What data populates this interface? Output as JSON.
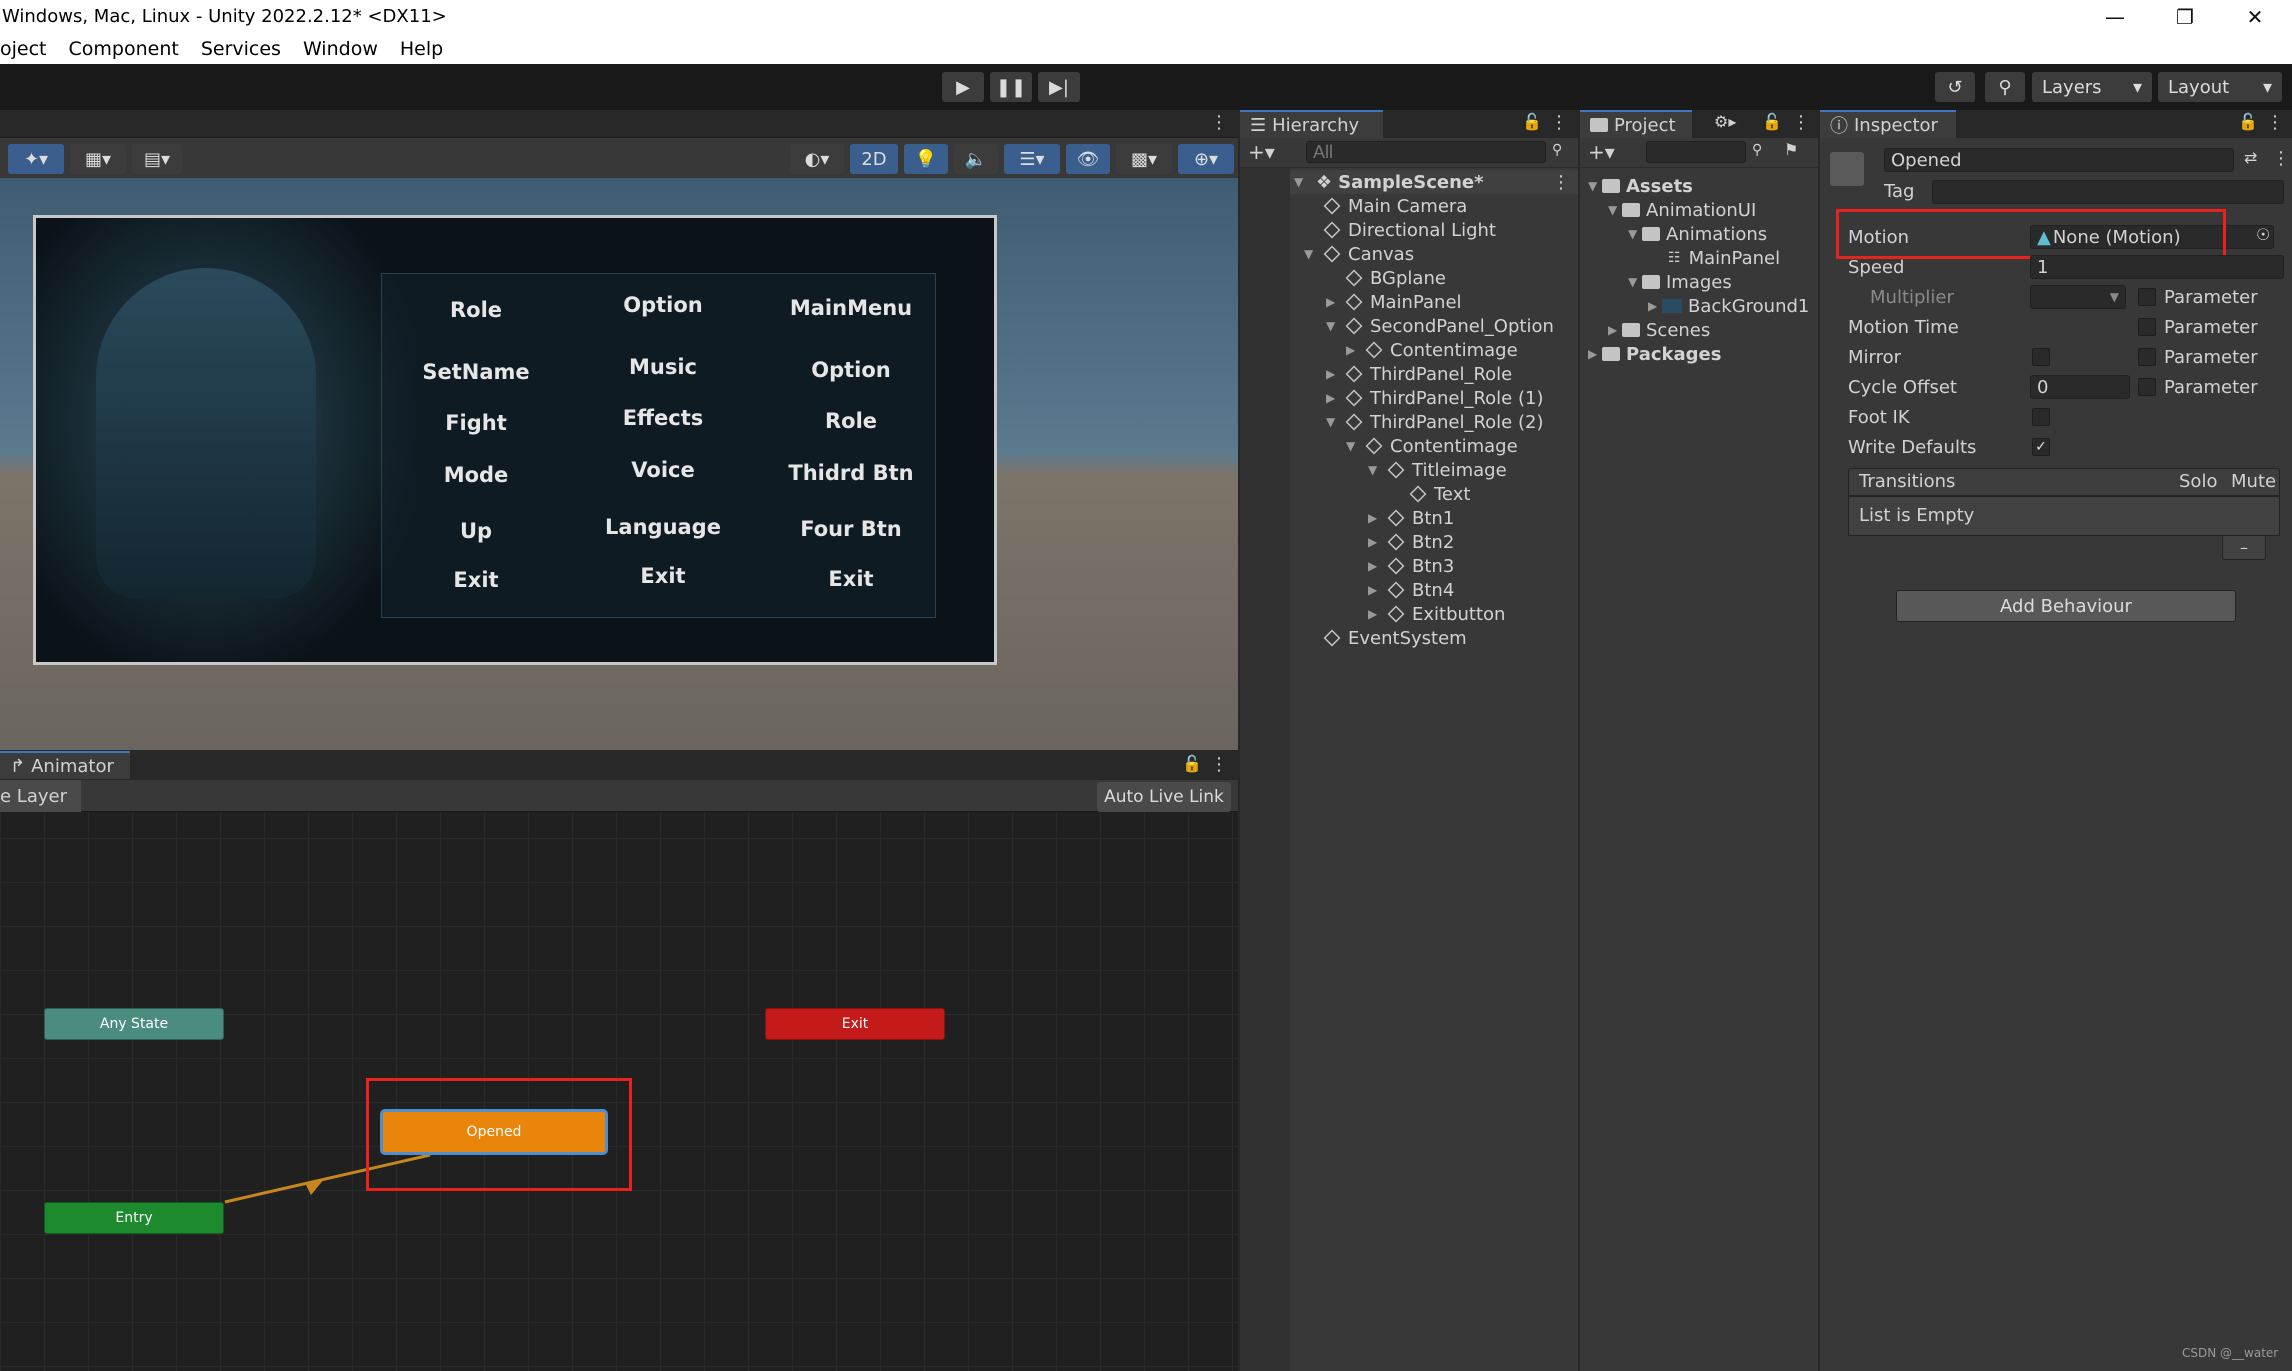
{
  "window": {
    "title": "Windows, Mac, Linux - Unity 2022.2.12* <DX11>"
  },
  "menu": [
    "oject",
    "Component",
    "Services",
    "Window",
    "Help"
  ],
  "toolbar": {
    "layers": "Layers",
    "layout": "Layout",
    "mode_2d": "2D"
  },
  "game": {
    "col1": [
      "Role",
      "SetName",
      "Fight",
      "Mode",
      "Up",
      "Exit"
    ],
    "col2": [
      "Option",
      "Music",
      "Effects",
      "Voice",
      "Language",
      "Exit"
    ],
    "col3": [
      "MainMenu",
      "Option",
      "Role",
      "Thidrd Btn",
      "Four Btn",
      "Exit"
    ]
  },
  "animator": {
    "tab": "Animator",
    "layer": "e Layer",
    "auto_live_link": "Auto Live Link",
    "nodes": {
      "any_state": "Any State",
      "exit": "Exit",
      "opened": "Opened",
      "entry": "Entry"
    }
  },
  "hierarchy": {
    "tab": "Hierarchy",
    "search_placeholder": "All",
    "scene": "SampleScene*",
    "items": [
      "Main Camera",
      "Directional Light",
      "Canvas",
      "BGplane",
      "MainPanel",
      "SecondPanel_Option",
      "Contentimage",
      "ThirdPanel_Role",
      "ThirdPanel_Role (1)",
      "ThirdPanel_Role (2)",
      "Contentimage",
      "Titleimage",
      "Text",
      "Btn1",
      "Btn2",
      "Btn3",
      "Btn4",
      "Exitbutton",
      "EventSystem"
    ]
  },
  "project": {
    "tab": "Project",
    "items": [
      "Assets",
      "AnimationUI",
      "Animations",
      "MainPanel",
      "Images",
      "BackGround1",
      "Scenes",
      "Packages"
    ]
  },
  "inspector": {
    "tab": "Inspector",
    "name": "Opened",
    "tag_label": "Tag",
    "motion_label": "Motion",
    "motion_value": "None (Motion)",
    "speed_label": "Speed",
    "speed_value": "1",
    "multiplier_label": "Multiplier",
    "parameter": "Parameter",
    "motion_time_label": "Motion Time",
    "mirror_label": "Mirror",
    "cycle_offset_label": "Cycle Offset",
    "cycle_offset_value": "0",
    "foot_ik_label": "Foot IK",
    "write_defaults_label": "Write Defaults",
    "transitions_label": "Transitions",
    "solo_label": "Solo",
    "mute_label": "Mute",
    "list_empty": "List is Empty",
    "minus": "–",
    "add_behaviour": "Add Behaviour"
  },
  "watermark": "CSDN @__water"
}
